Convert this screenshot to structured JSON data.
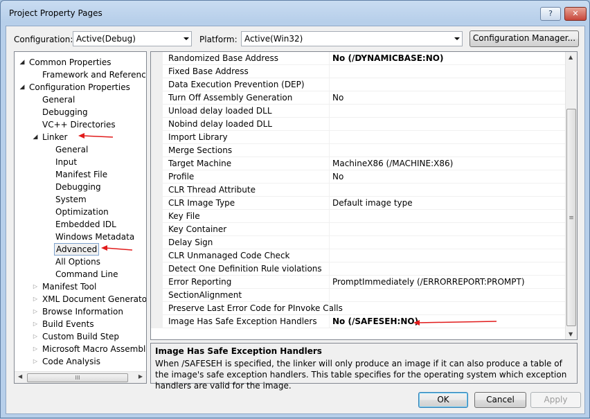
{
  "window": {
    "title": "Project Property Pages",
    "help_label": "?",
    "close_label": "✕"
  },
  "top": {
    "configuration_label": "Configuration:",
    "configuration_value": "Active(Debug)",
    "platform_label": "Platform:",
    "platform_value": "Active(Win32)",
    "config_manager_label": "Configuration Manager..."
  },
  "tree": {
    "items": [
      {
        "label": "Common Properties",
        "state": "open"
      },
      {
        "label": "Framework and References",
        "state": "none"
      },
      {
        "label": "Configuration Properties",
        "state": "open"
      },
      {
        "label": "General",
        "state": "none"
      },
      {
        "label": "Debugging",
        "state": "none"
      },
      {
        "label": "VC++ Directories",
        "state": "none"
      },
      {
        "label": "Linker",
        "state": "open"
      },
      {
        "label": "General",
        "state": "none"
      },
      {
        "label": "Input",
        "state": "none"
      },
      {
        "label": "Manifest File",
        "state": "none"
      },
      {
        "label": "Debugging",
        "state": "none"
      },
      {
        "label": "System",
        "state": "none"
      },
      {
        "label": "Optimization",
        "state": "none"
      },
      {
        "label": "Embedded IDL",
        "state": "none"
      },
      {
        "label": "Windows Metadata",
        "state": "none"
      },
      {
        "label": "Advanced",
        "state": "selected"
      },
      {
        "label": "All Options",
        "state": "none"
      },
      {
        "label": "Command Line",
        "state": "none"
      },
      {
        "label": "Manifest Tool",
        "state": "closed"
      },
      {
        "label": "XML Document Generator",
        "state": "closed"
      },
      {
        "label": "Browse Information",
        "state": "closed"
      },
      {
        "label": "Build Events",
        "state": "closed"
      },
      {
        "label": "Custom Build Step",
        "state": "closed"
      },
      {
        "label": "Microsoft Macro Assembler",
        "state": "closed"
      },
      {
        "label": "Code Analysis",
        "state": "closed"
      }
    ],
    "scroll_grip": "III"
  },
  "grid": {
    "rows": [
      {
        "name": "Randomized Base Address",
        "value": "No (/DYNAMICBASE:NO)",
        "bold": true
      },
      {
        "name": "Fixed Base Address",
        "value": ""
      },
      {
        "name": "Data Execution Prevention (DEP)",
        "value": ""
      },
      {
        "name": "Turn Off Assembly Generation",
        "value": "No"
      },
      {
        "name": "Unload delay loaded DLL",
        "value": ""
      },
      {
        "name": "Nobind delay loaded DLL",
        "value": ""
      },
      {
        "name": "Import Library",
        "value": ""
      },
      {
        "name": "Merge Sections",
        "value": ""
      },
      {
        "name": "Target Machine",
        "value": "MachineX86 (/MACHINE:X86)"
      },
      {
        "name": "Profile",
        "value": "No"
      },
      {
        "name": "CLR Thread Attribute",
        "value": ""
      },
      {
        "name": "CLR Image Type",
        "value": "Default image type"
      },
      {
        "name": "Key File",
        "value": ""
      },
      {
        "name": "Key Container",
        "value": ""
      },
      {
        "name": "Delay Sign",
        "value": ""
      },
      {
        "name": "CLR Unmanaged Code Check",
        "value": ""
      },
      {
        "name": "Detect One Definition Rule violations",
        "value": ""
      },
      {
        "name": "Error Reporting",
        "value": "PromptImmediately (/ERRORREPORT:PROMPT)"
      },
      {
        "name": "SectionAlignment",
        "value": ""
      },
      {
        "name": "Preserve Last Error Code for PInvoke Calls",
        "value": ""
      },
      {
        "name": "Image Has Safe Exception Handlers",
        "value": "No (/SAFESEH:NO)",
        "bold": true
      }
    ],
    "scroll_grip": "≡"
  },
  "description": {
    "title": "Image Has Safe Exception Handlers",
    "text": "When /SAFESEH is specified, the linker will only produce an image if it can also produce a table of the image's safe exception handlers. This table specifies for the operating system which exception handlers are valid for the image."
  },
  "buttons": {
    "ok": "OK",
    "cancel": "Cancel",
    "apply": "Apply"
  },
  "colors": {
    "annotation_arrow": "#e11b1b",
    "selection_border": "#7da2ce"
  }
}
